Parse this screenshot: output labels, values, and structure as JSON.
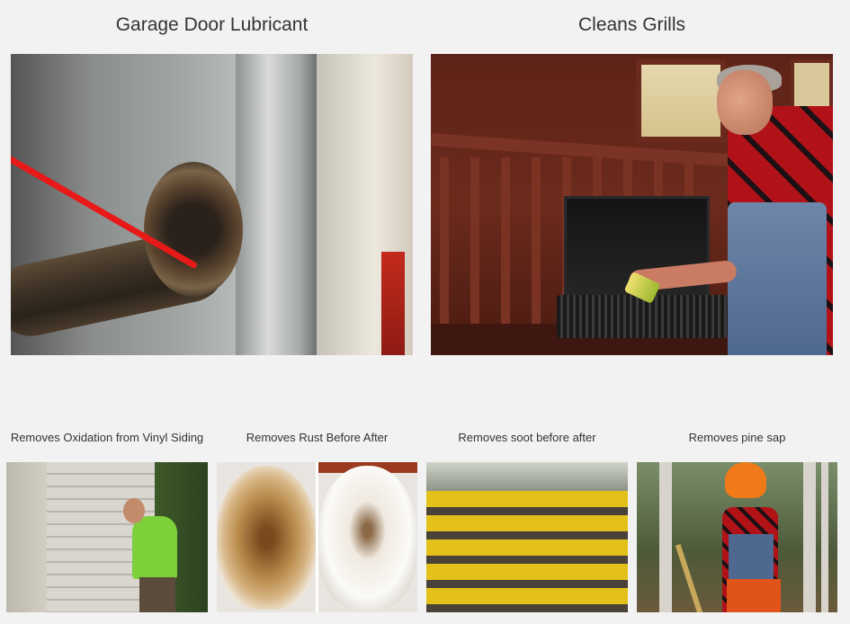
{
  "features": {
    "garage": {
      "caption": "Garage Door Lubricant"
    },
    "grills": {
      "caption": "Cleans Grills"
    }
  },
  "examples": [
    {
      "caption": "Removes Oxidation from Vinyl Siding"
    },
    {
      "caption": "Removes Rust Before After"
    },
    {
      "caption": "Removes soot before after"
    },
    {
      "caption": "Removes pine sap"
    }
  ],
  "colors": {
    "background": "#f2f2f2",
    "text": "#333333"
  }
}
